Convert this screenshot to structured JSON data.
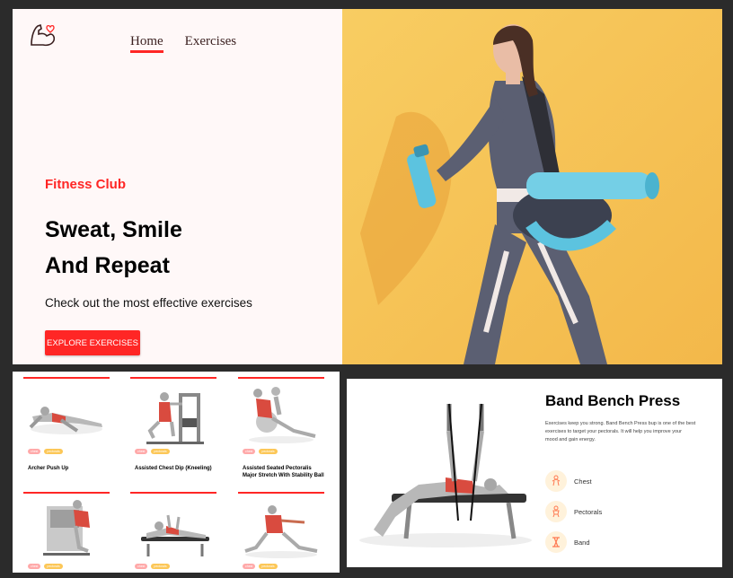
{
  "colors": {
    "accent": "#ff2625",
    "tag_red": "#ffa9a9",
    "tag_yellow": "#fcc757",
    "hero_bg": "#fff8f8",
    "photo_bg": "#f6c45a"
  },
  "nav": {
    "home": "Home",
    "exercises": "Exercises"
  },
  "hero": {
    "kicker": "Fitness Club",
    "headline_line1": "Sweat, Smile",
    "headline_line2": "And Repeat",
    "subline": "Check out the most effective exercises",
    "cta": "EXPLORE EXERCISES"
  },
  "cards": [
    {
      "name": "Archer Push Up",
      "tags": [
        "chest",
        "pectorals"
      ]
    },
    {
      "name": "Assisted Chest Dip (Kneeling)",
      "tags": [
        "chest",
        "pectorals"
      ]
    },
    {
      "name": "Assisted Seated Pectoralis Major Stretch With Stability Ball",
      "tags": [
        "chest",
        "pectorals"
      ]
    },
    {
      "name": "",
      "tags": [
        "chest",
        "pectorals"
      ]
    },
    {
      "name": "",
      "tags": [
        "chest",
        "pectorals"
      ]
    },
    {
      "name": "",
      "tags": [
        "chest",
        "pectorals"
      ]
    }
  ],
  "detail": {
    "title": "Band Bench Press",
    "description_line1": "Exercises keep you strong. Band Bench Press bup is one of the best",
    "description_line2": "exercises to target your pectorals. It will help you improve your",
    "description_line3": "mood and gain energy.",
    "stats": [
      {
        "label": "Chest",
        "icon": "body-part-icon"
      },
      {
        "label": "Pectorals",
        "icon": "target-icon"
      },
      {
        "label": "Band",
        "icon": "equipment-icon"
      }
    ]
  }
}
